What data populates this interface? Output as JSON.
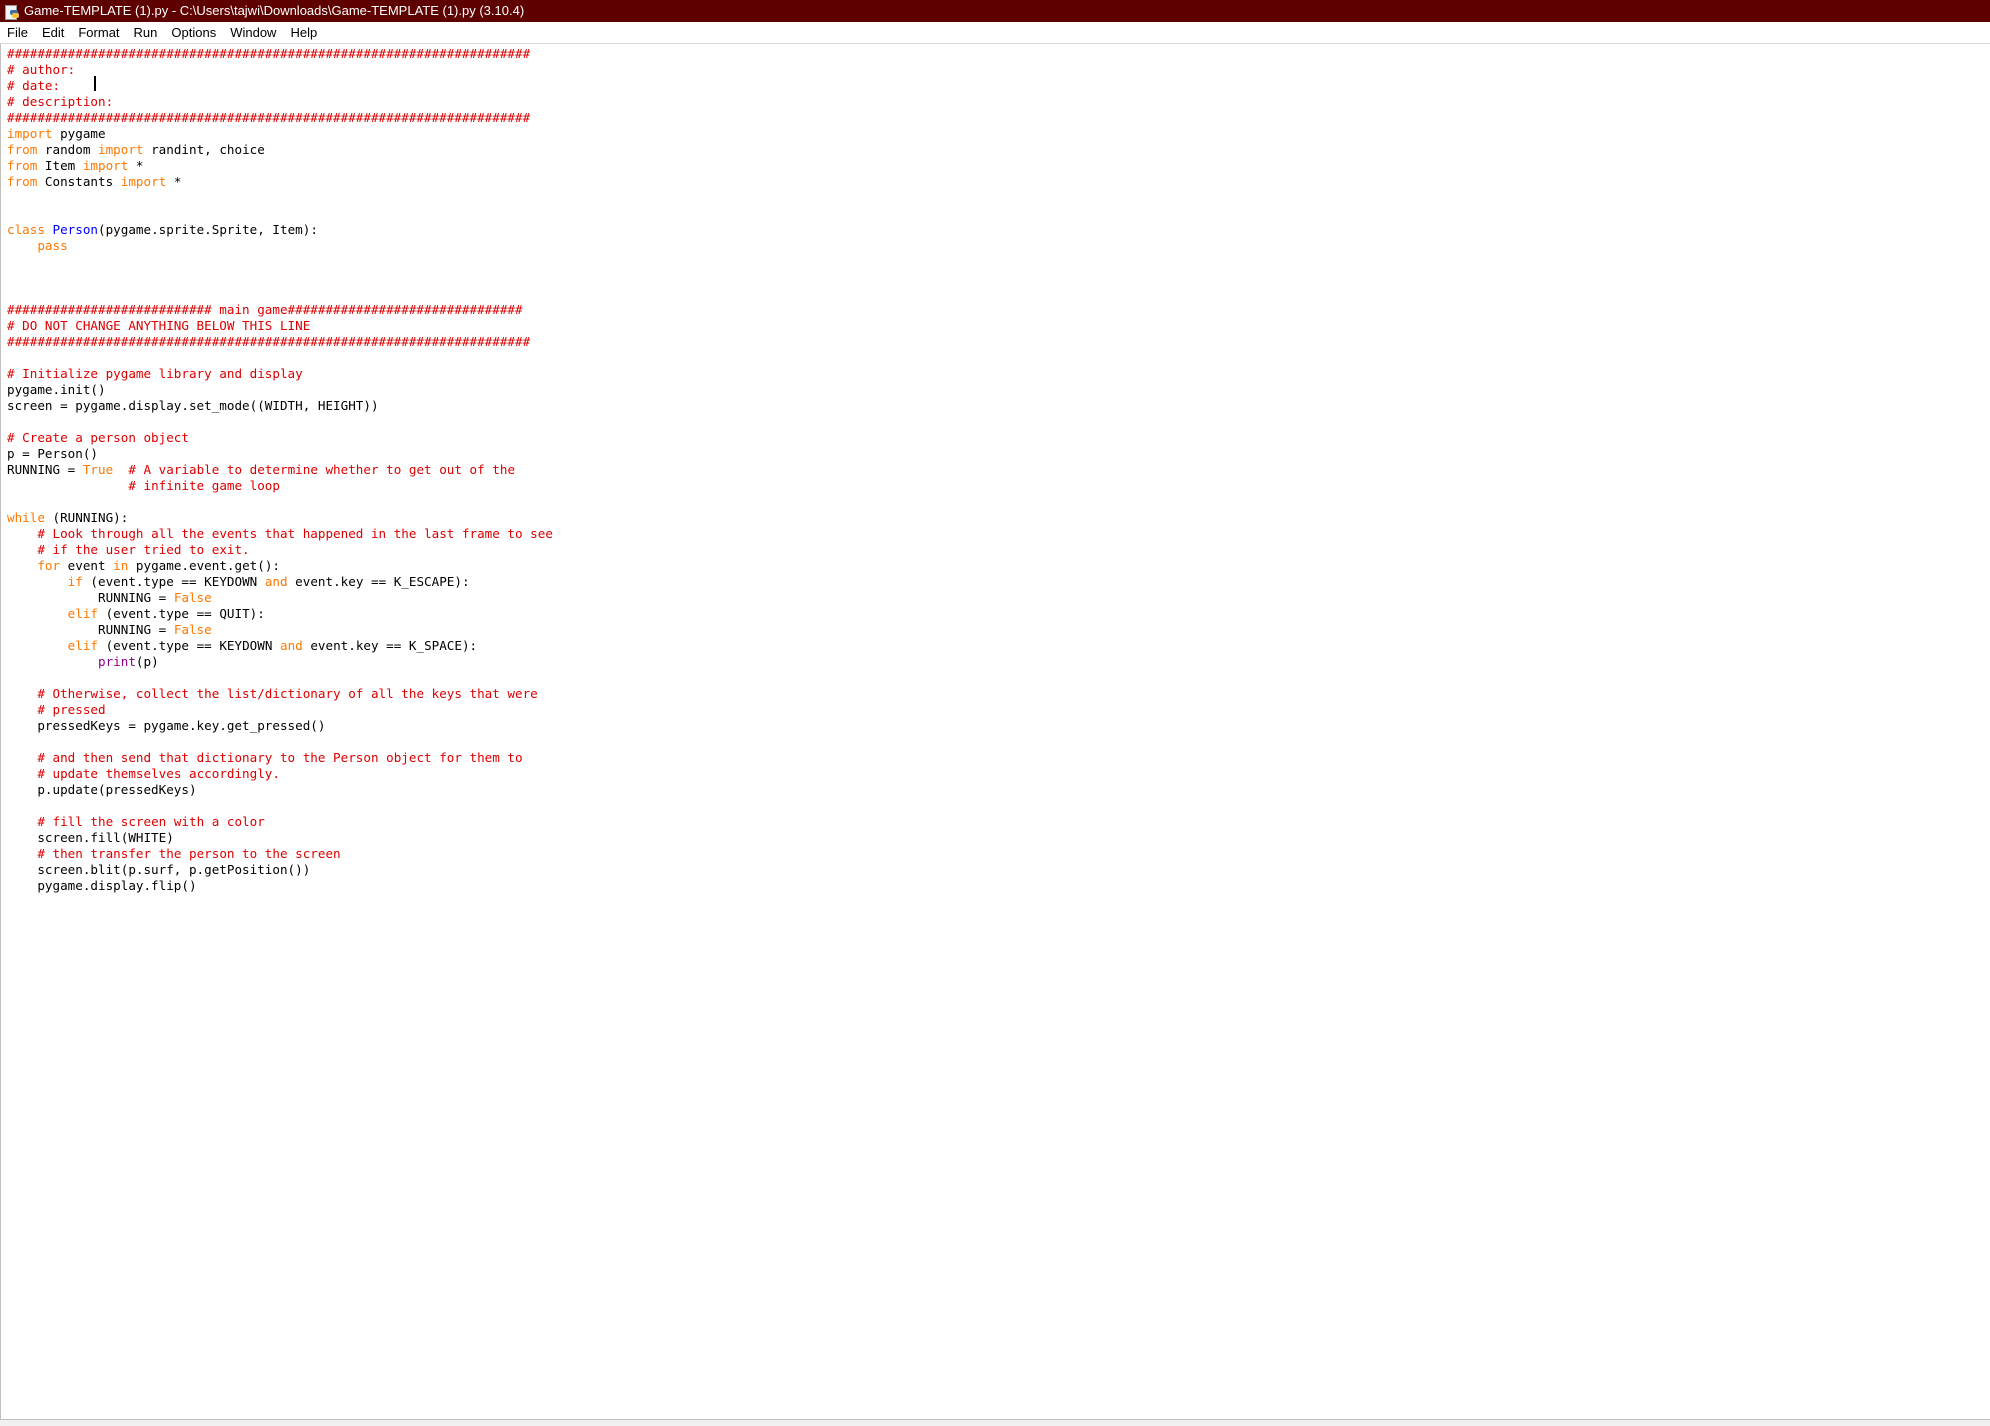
{
  "window": {
    "title": "Game-TEMPLATE (1).py - C:\\Users\\tajwi\\Downloads\\Game-TEMPLATE (1).py (3.10.4)",
    "icon": "python-file-icon"
  },
  "menu": {
    "items": [
      {
        "label": "File"
      },
      {
        "label": "Edit"
      },
      {
        "label": "Format"
      },
      {
        "label": "Run"
      },
      {
        "label": "Options"
      },
      {
        "label": "Window"
      },
      {
        "label": "Help"
      }
    ]
  },
  "colors": {
    "titlebar": "#5f0000",
    "keyword": "#ff7700",
    "comment": "#dd0000",
    "builtin": "#900090",
    "definition": "#0000ff"
  },
  "code": {
    "lines": [
      [
        [
          "cm",
          "#####################################################################"
        ]
      ],
      [
        [
          "cm",
          "# author:"
        ]
      ],
      [
        [
          "cm",
          "# date:"
        ]
      ],
      [
        [
          "cm",
          "# description:"
        ]
      ],
      [
        [
          "cm",
          "#####################################################################"
        ]
      ],
      [
        [
          "kw",
          "import"
        ],
        [
          "nm",
          " pygame"
        ]
      ],
      [
        [
          "kw",
          "from"
        ],
        [
          "nm",
          " random "
        ],
        [
          "kw",
          "import"
        ],
        [
          "nm",
          " randint, choice"
        ]
      ],
      [
        [
          "kw",
          "from"
        ],
        [
          "nm",
          " Item "
        ],
        [
          "kw",
          "import"
        ],
        [
          "nm",
          " *"
        ]
      ],
      [
        [
          "kw",
          "from"
        ],
        [
          "nm",
          " Constants "
        ],
        [
          "kw",
          "import"
        ],
        [
          "nm",
          " *"
        ]
      ],
      [],
      [],
      [
        [
          "kw",
          "class"
        ],
        [
          "nm",
          " "
        ],
        [
          "df",
          "Person"
        ],
        [
          "nm",
          "(pygame.sprite.Sprite, Item):"
        ]
      ],
      [
        [
          "nm",
          "    "
        ],
        [
          "kw",
          "pass"
        ]
      ],
      [],
      [],
      [],
      [
        [
          "cm",
          "########################### main game###############################"
        ]
      ],
      [
        [
          "cm",
          "# DO NOT CHANGE ANYTHING BELOW THIS LINE"
        ]
      ],
      [
        [
          "cm",
          "#####################################################################"
        ]
      ],
      [],
      [
        [
          "cm",
          "# Initialize pygame library and display"
        ]
      ],
      [
        [
          "nm",
          "pygame.init()"
        ]
      ],
      [
        [
          "nm",
          "screen = pygame.display.set_mode((WIDTH, HEIGHT))"
        ]
      ],
      [],
      [
        [
          "cm",
          "# Create a person object"
        ]
      ],
      [
        [
          "nm",
          "p = Person()"
        ]
      ],
      [
        [
          "nm",
          "RUNNING = "
        ],
        [
          "kw",
          "True"
        ],
        [
          "nm",
          "  "
        ],
        [
          "cm",
          "# A variable to determine whether to get out of the"
        ]
      ],
      [
        [
          "nm",
          "                "
        ],
        [
          "cm",
          "# infinite game loop"
        ]
      ],
      [],
      [
        [
          "kw",
          "while"
        ],
        [
          "nm",
          " (RUNNING):"
        ]
      ],
      [
        [
          "nm",
          "    "
        ],
        [
          "cm",
          "# Look through all the events that happened in the last frame to see"
        ]
      ],
      [
        [
          "nm",
          "    "
        ],
        [
          "cm",
          "# if the user tried to exit."
        ]
      ],
      [
        [
          "nm",
          "    "
        ],
        [
          "kw",
          "for"
        ],
        [
          "nm",
          " event "
        ],
        [
          "kw",
          "in"
        ],
        [
          "nm",
          " pygame.event.get():"
        ]
      ],
      [
        [
          "nm",
          "        "
        ],
        [
          "kw",
          "if"
        ],
        [
          "nm",
          " (event.type == KEYDOWN "
        ],
        [
          "kw",
          "and"
        ],
        [
          "nm",
          " event.key == K_ESCAPE):"
        ]
      ],
      [
        [
          "nm",
          "            RUNNING = "
        ],
        [
          "kw",
          "False"
        ]
      ],
      [
        [
          "nm",
          "        "
        ],
        [
          "kw",
          "elif"
        ],
        [
          "nm",
          " (event.type == QUIT):"
        ]
      ],
      [
        [
          "nm",
          "            RUNNING = "
        ],
        [
          "kw",
          "False"
        ]
      ],
      [
        [
          "nm",
          "        "
        ],
        [
          "kw",
          "elif"
        ],
        [
          "nm",
          " (event.type == KEYDOWN "
        ],
        [
          "kw",
          "and"
        ],
        [
          "nm",
          " event.key == K_SPACE):"
        ]
      ],
      [
        [
          "nm",
          "            "
        ],
        [
          "bi",
          "print"
        ],
        [
          "nm",
          "(p)"
        ]
      ],
      [],
      [
        [
          "nm",
          "    "
        ],
        [
          "cm",
          "# Otherwise, collect the list/dictionary of all the keys that were"
        ]
      ],
      [
        [
          "nm",
          "    "
        ],
        [
          "cm",
          "# pressed"
        ]
      ],
      [
        [
          "nm",
          "    pressedKeys = pygame.key.get_pressed()"
        ]
      ],
      [],
      [
        [
          "nm",
          "    "
        ],
        [
          "cm",
          "# and then send that dictionary to the Person object for them to"
        ]
      ],
      [
        [
          "nm",
          "    "
        ],
        [
          "cm",
          "# update themselves accordingly."
        ]
      ],
      [
        [
          "nm",
          "    p.update(pressedKeys)"
        ]
      ],
      [],
      [
        [
          "nm",
          "    "
        ],
        [
          "cm",
          "# fill the screen with a color"
        ]
      ],
      [
        [
          "nm",
          "    screen.fill(WHITE)"
        ]
      ],
      [
        [
          "nm",
          "    "
        ],
        [
          "cm",
          "# then transfer the person to the screen"
        ]
      ],
      [
        [
          "nm",
          "    screen.blit(p.surf, p.getPosition())"
        ]
      ],
      [
        [
          "nm",
          "    pygame.display.flip()"
        ]
      ]
    ]
  }
}
